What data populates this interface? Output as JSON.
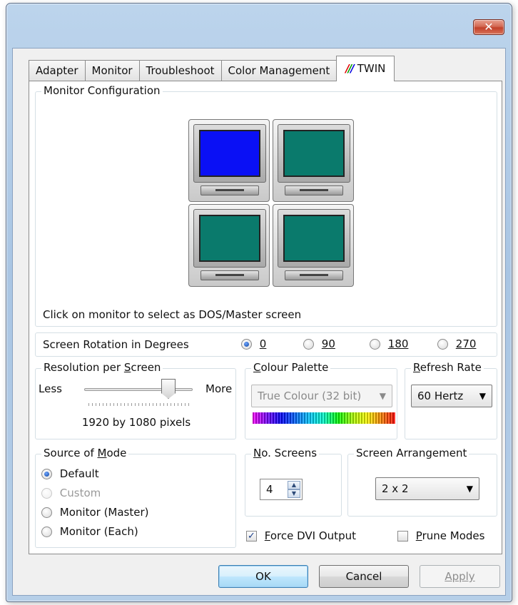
{
  "window": {
    "close_label": "✕"
  },
  "tabs": [
    {
      "label": "Adapter"
    },
    {
      "label": "Monitor"
    },
    {
      "label": "Troubleshoot"
    },
    {
      "label": "Color Management"
    },
    {
      "label": "TWIN",
      "logo": "///"
    }
  ],
  "monitor_config": {
    "title": "Monitor Configuration",
    "hint": "Click on monitor to select as DOS/Master screen",
    "screen_colors": [
      "#0a10f5",
      "#0a7a6c",
      "#0a7a6c",
      "#0a7a6c"
    ]
  },
  "rotation": {
    "label": "Screen Rotation in Degrees",
    "options": [
      {
        "value": "0",
        "checked": true
      },
      {
        "value": "90",
        "checked": false
      },
      {
        "value": "180",
        "checked": false
      },
      {
        "value": "270",
        "checked": false
      }
    ]
  },
  "resolution": {
    "title": "Resolution per Screen",
    "less": "Less",
    "more": "More",
    "value_text": "1920 by 1080 pixels"
  },
  "colour_palette": {
    "title": "Colour Palette",
    "selected": "True Colour (32 bit)"
  },
  "refresh_rate": {
    "title": "Refresh Rate",
    "selected": "60 Hertz"
  },
  "source_of_mode": {
    "title": "Source of Mode",
    "options": [
      {
        "label": "Default",
        "checked": true,
        "disabled": false
      },
      {
        "label": "Custom",
        "checked": false,
        "disabled": true
      },
      {
        "label": "Monitor (Master)",
        "checked": false,
        "disabled": false
      },
      {
        "label": "Monitor (Each)",
        "checked": false,
        "disabled": false
      }
    ]
  },
  "screens": {
    "title": "No. Screens",
    "value": "4"
  },
  "arrangement": {
    "title": "Screen Arrangement",
    "selected": "2 x 2"
  },
  "force_dvi": {
    "label": "Force DVI Output",
    "checked": true
  },
  "prune_modes": {
    "label": "Prune Modes",
    "checked": false
  },
  "buttons": {
    "ok": "OK",
    "cancel": "Cancel",
    "apply": "Apply"
  },
  "icons": {
    "dropdown": "▼",
    "spin_up": "▲",
    "spin_down": "▼",
    "check": "✓"
  }
}
